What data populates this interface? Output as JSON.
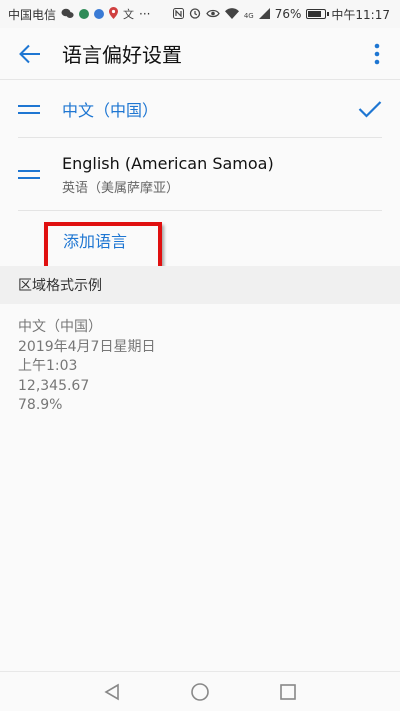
{
  "status_bar": {
    "carrier": "中国电信",
    "notif_icons": [
      "wechat-icon",
      "app-icon",
      "browser-icon",
      "location-icon",
      "translate-icon"
    ],
    "more": "···",
    "signal_label": "4G",
    "battery_percent": "76%",
    "battery_level": 0.76,
    "time": "中午11:17"
  },
  "app_bar": {
    "title": "语言偏好设置"
  },
  "languages": [
    {
      "name": "中文（中国）",
      "selected": true
    },
    {
      "name": "English (American Samoa)",
      "native": "英语（美属萨摩亚）",
      "selected": false
    }
  ],
  "add_language_label": "添加语言",
  "region": {
    "header": "区域格式示例",
    "lines": [
      "中文（中国）",
      "2019年4月7日星期日",
      "上午1:03",
      "12,345.67",
      "78.9%"
    ]
  },
  "colors": {
    "accent": "#1e76d2",
    "highlight_box": "#e01010"
  }
}
